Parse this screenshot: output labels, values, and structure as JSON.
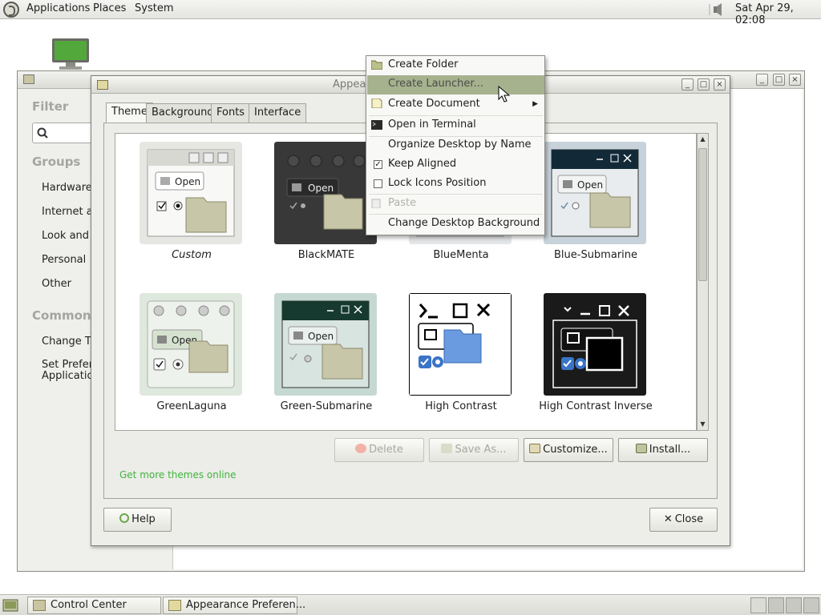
{
  "top_panel": {
    "menus": [
      "Applications",
      "Places",
      "System"
    ],
    "datetime": "Sat Apr 29, 02:08"
  },
  "control_center": {
    "filter_heading": "Filter",
    "groups_heading": "Groups",
    "groups": [
      "Hardware",
      "Internet an",
      "Look and F",
      "Personal",
      "Other"
    ],
    "common_heading": "Common",
    "common": [
      "Change Th",
      "Set Prefer",
      "Application"
    ]
  },
  "appearance": {
    "title": "Appea",
    "tabs": [
      "Theme",
      "Background",
      "Fonts",
      "Interface"
    ],
    "active_tab": "Theme",
    "themes": [
      {
        "name": "Custom",
        "italic": true
      },
      {
        "name": "BlackMATE"
      },
      {
        "name": "BlueMenta"
      },
      {
        "name": "Blue-Submarine"
      },
      {
        "name": "GreenLaguna"
      },
      {
        "name": "Green-Submarine"
      },
      {
        "name": "High Contrast"
      },
      {
        "name": "High Contrast Inverse"
      }
    ],
    "thumb_open_label": "Open",
    "buttons": {
      "delete": "Delete",
      "save_as": "Save As...",
      "customize": "Customize...",
      "install": "Install..."
    },
    "more_link": "Get more themes online",
    "help": "Help",
    "close": "Close"
  },
  "context_menu": {
    "items": [
      {
        "label": "Create Folder"
      },
      {
        "label": "Create Launcher...",
        "state": "hover"
      },
      {
        "label": "Create Document",
        "submenu": true
      },
      {
        "label": "Open in Terminal"
      },
      {
        "label": "Organize Desktop by Name"
      },
      {
        "label": "Keep Aligned",
        "checked": true
      },
      {
        "label": "Lock Icons Position",
        "checked": false
      },
      {
        "label": "Paste",
        "disabled": true
      },
      {
        "label": "Change Desktop Background"
      }
    ]
  },
  "taskbar": {
    "tasks": [
      "Control Center",
      "Appearance Preferen..."
    ]
  }
}
